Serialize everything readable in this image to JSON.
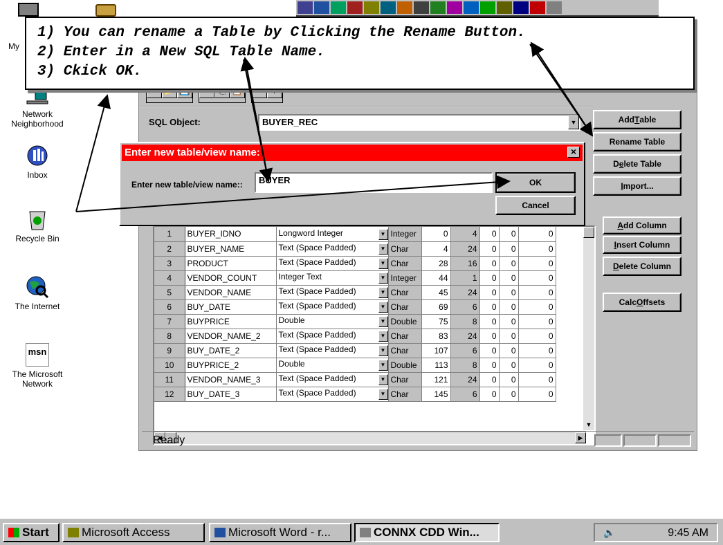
{
  "desktop": {
    "icons": [
      {
        "label": "My"
      },
      {
        "label": "Network Neighborhood"
      },
      {
        "label": "Inbox"
      },
      {
        "label": "Recycle Bin"
      },
      {
        "label": "The Internet"
      },
      {
        "label": "The Microsoft Network"
      }
    ],
    "msn_logo": "msn"
  },
  "callout": {
    "line1": "1) You can rename a Table by Clicking the Rename Button.",
    "line2": "2) Enter in a New SQL Table Name.",
    "line3": "3) Ckick OK."
  },
  "app": {
    "sql_object_label": "SQL Object:",
    "sql_object_value": "BUYER_REC",
    "buttons": {
      "add_table": {
        "pre": "Add ",
        "u": "T",
        "post": "able"
      },
      "rename_table": "Rename Table",
      "delete_table": {
        "pre": "D",
        "u": "e",
        "post": "lete Table"
      },
      "import": {
        "pre": "",
        "u": "I",
        "post": "mport..."
      },
      "add_column": {
        "pre": "",
        "u": "A",
        "post": "dd Column"
      },
      "insert_column": {
        "pre": "",
        "u": "I",
        "post": "nsert Column"
      },
      "delete_column": {
        "pre": "",
        "u": "D",
        "post": "elete Column"
      },
      "calc_offsets": {
        "pre": "Calc ",
        "u": "O",
        "post": "ffsets"
      }
    },
    "status": "Ready",
    "toolbar_icons": [
      "new-file-icon",
      "open-folder-icon",
      "save-icon",
      "cut-icon",
      "copy-icon",
      "paste-icon",
      "print-icon",
      "help-icon"
    ]
  },
  "grid": {
    "rows": [
      {
        "n": "1",
        "name": "BUYER_IDNO",
        "type": "Longword Integer",
        "sql": "Integer",
        "off": "0",
        "len": "4",
        "d": "0",
        "s": "0",
        "a": "0"
      },
      {
        "n": "2",
        "name": "BUYER_NAME",
        "type": "Text (Space Padded)",
        "sql": "Char",
        "off": "4",
        "len": "24",
        "d": "0",
        "s": "0",
        "a": "0"
      },
      {
        "n": "3",
        "name": "PRODUCT",
        "type": "Text (Space Padded)",
        "sql": "Char",
        "off": "28",
        "len": "16",
        "d": "0",
        "s": "0",
        "a": "0"
      },
      {
        "n": "4",
        "name": "VENDOR_COUNT",
        "type": "Integer Text",
        "sql": "Integer",
        "off": "44",
        "len": "1",
        "d": "0",
        "s": "0",
        "a": "0"
      },
      {
        "n": "5",
        "name": "VENDOR_NAME",
        "type": "Text (Space Padded)",
        "sql": "Char",
        "off": "45",
        "len": "24",
        "d": "0",
        "s": "0",
        "a": "0"
      },
      {
        "n": "6",
        "name": "BUY_DATE",
        "type": "Text (Space Padded)",
        "sql": "Char",
        "off": "69",
        "len": "6",
        "d": "0",
        "s": "0",
        "a": "0"
      },
      {
        "n": "7",
        "name": "BUYPRICE",
        "type": "Double",
        "sql": "Double",
        "off": "75",
        "len": "8",
        "d": "0",
        "s": "0",
        "a": "0"
      },
      {
        "n": "8",
        "name": "VENDOR_NAME_2",
        "type": "Text (Space Padded)",
        "sql": "Char",
        "off": "83",
        "len": "24",
        "d": "0",
        "s": "0",
        "a": "0"
      },
      {
        "n": "9",
        "name": "BUY_DATE_2",
        "type": "Text (Space Padded)",
        "sql": "Char",
        "off": "107",
        "len": "6",
        "d": "0",
        "s": "0",
        "a": "0"
      },
      {
        "n": "10",
        "name": "BUYPRICE_2",
        "type": "Double",
        "sql": "Double",
        "off": "113",
        "len": "8",
        "d": "0",
        "s": "0",
        "a": "0"
      },
      {
        "n": "11",
        "name": "VENDOR_NAME_3",
        "type": "Text (Space Padded)",
        "sql": "Char",
        "off": "121",
        "len": "24",
        "d": "0",
        "s": "0",
        "a": "0"
      },
      {
        "n": "12",
        "name": "BUY_DATE_3",
        "type": "Text (Space Padded)",
        "sql": "Char",
        "off": "145",
        "len": "6",
        "d": "0",
        "s": "0",
        "a": "0"
      }
    ]
  },
  "dialog": {
    "title": "Enter new table/view name:",
    "field_label": "Enter new table/view name::",
    "field_value": "BUYER",
    "ok": "OK",
    "cancel": "Cancel",
    "close": "×"
  },
  "taskbar": {
    "start": "Start",
    "tasks": [
      "Microsoft Access",
      "Microsoft Word - r...",
      "CONNX CDD Win..."
    ],
    "clock": "9:45 AM"
  },
  "colors": {
    "dialog_title": "#ff0000",
    "desktop": "#ffffff",
    "face": "#c0c0c0"
  }
}
